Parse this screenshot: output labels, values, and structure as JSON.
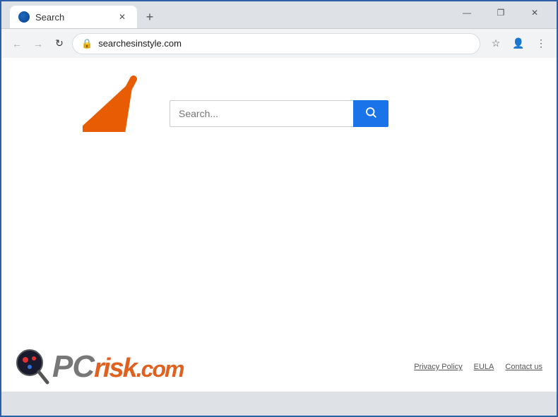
{
  "browser": {
    "tab": {
      "label": "Search",
      "favicon_alt": "browser-favicon"
    },
    "new_tab_label": "+",
    "window_controls": {
      "minimize": "—",
      "maximize": "❐",
      "close": "✕"
    },
    "address_bar": {
      "url": "searchesinstyle.com",
      "lock_icon": "🔒",
      "bookmark_icon": "☆",
      "profile_icon": "👤",
      "menu_icon": "⋮"
    },
    "nav": {
      "back": "←",
      "forward": "→",
      "reload": "↻"
    }
  },
  "page": {
    "search_placeholder": "Search...",
    "search_button_icon": "🔍"
  },
  "watermark": {
    "logo_pc": "PC",
    "logo_risk": "risk",
    "logo_dot_com": ".com",
    "footer_links": [
      "Privacy Policy",
      "EULA",
      "Contact us"
    ]
  }
}
